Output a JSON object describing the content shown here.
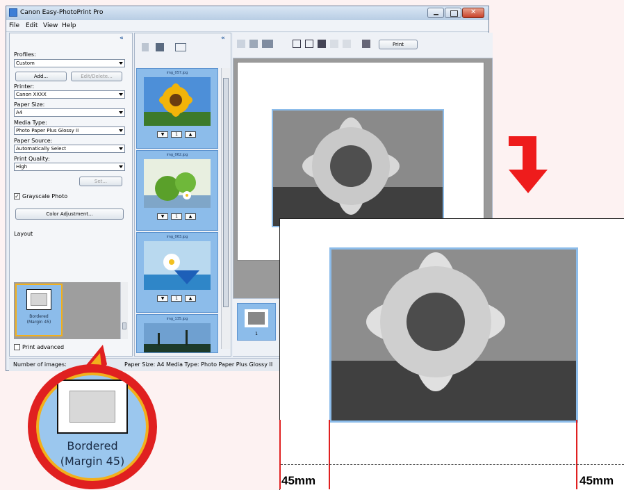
{
  "window": {
    "title": "Canon Easy-PhotoPrint Pro"
  },
  "menu": {
    "items": [
      "File",
      "Edit",
      "View",
      "Help"
    ]
  },
  "left_panel": {
    "profiles_label": "Profiles:",
    "profiles_value": "Custom",
    "add_button": "Add...",
    "edit_delete_button": "Edit/Delete...",
    "printer_label": "Printer:",
    "printer_value": "Canon XXXX",
    "paper_size_label": "Paper Size:",
    "paper_size_value": "A4",
    "media_type_label": "Media Type:",
    "media_type_value": "Photo Paper Plus Glossy II",
    "paper_source_label": "Paper Source:",
    "paper_source_value": "Automatically Select",
    "print_quality_label": "Print Quality:",
    "print_quality_value": "High",
    "set_button": "Set...",
    "grayscale_label": "Grayscale Photo",
    "color_adjustment_button": "Color Adjustment...",
    "layout_label": "Layout",
    "layout_item_line1": "Bordered",
    "layout_item_line2": "(Margin 45)",
    "print_advanced_label": "Print advanced"
  },
  "thumbnails": [
    {
      "filename": "img_057.jpg",
      "count": "1"
    },
    {
      "filename": "img_062.jpg",
      "count": "1"
    },
    {
      "filename": "img_063.jpg",
      "count": "1"
    },
    {
      "filename": "img_135.jpg",
      "count": ""
    }
  ],
  "toolbar": {
    "print_button": "Print"
  },
  "page_strip": {
    "page_number": "1"
  },
  "status_bar": {
    "images": "Number of images:",
    "paper_info": "Paper Size: A4  Media Type: Photo Paper Plus Glossy II"
  },
  "callout": {
    "line1": "Bordered",
    "line2": "(Margin 45)"
  },
  "dimensions": {
    "left": "45mm",
    "right": "45mm"
  },
  "colors": {
    "accent_blue": "#8cbcea",
    "highlight_orange": "#f2b01c",
    "callout_red": "#e02020"
  }
}
